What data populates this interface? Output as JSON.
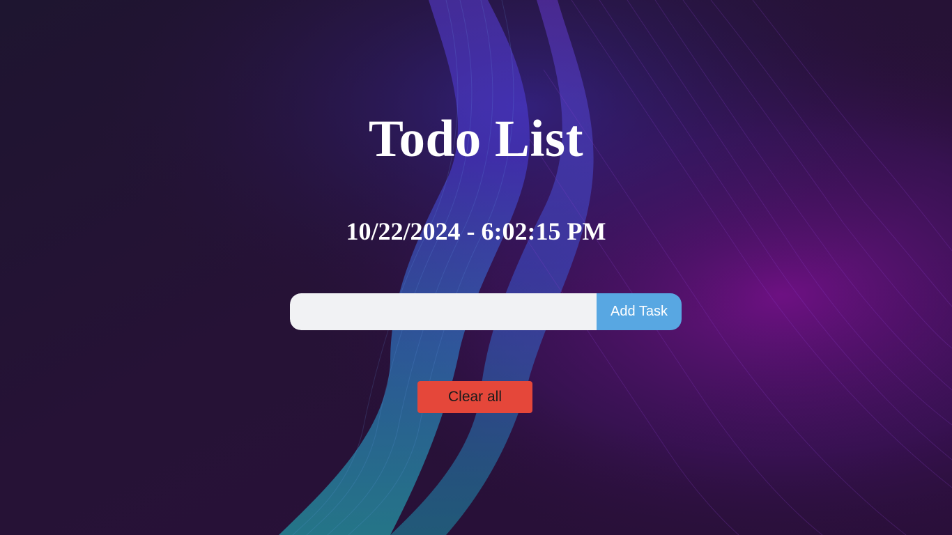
{
  "header": {
    "title": "Todo List",
    "datetime": "10/22/2024 - 6:02:15 PM"
  },
  "form": {
    "input_value": "",
    "input_placeholder": "",
    "add_button_label": "Add Task"
  },
  "actions": {
    "clear_all_label": "Clear all"
  },
  "colors": {
    "background": "#1f1433",
    "add_button": "#58a7e2",
    "clear_button": "#e5473a",
    "input_background": "#f1f2f4",
    "title_text": "#ffffff"
  }
}
